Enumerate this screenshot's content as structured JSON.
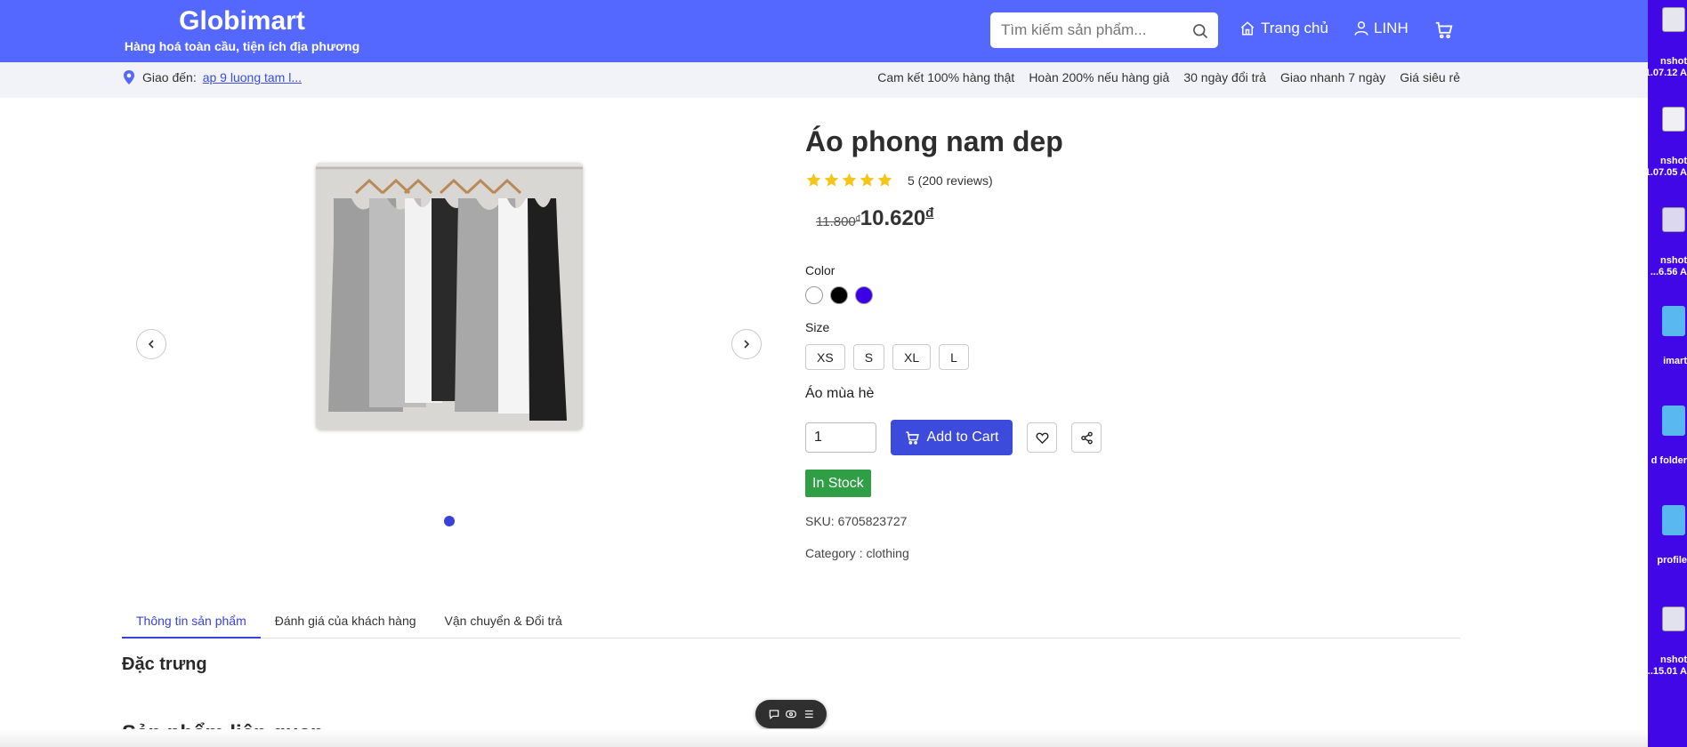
{
  "header": {
    "brand_name": "Globimart",
    "brand_tagline": "Hàng hoá toàn cầu, tiện ích địa phương",
    "search_placeholder": "Tìm kiếm sản phẩm...",
    "home_label": "Trang chủ",
    "user_label": "LINH"
  },
  "subbar": {
    "deliver_label": "Giao đến:",
    "deliver_address": "ap 9 luong tam l...",
    "promos": [
      "Cam kết 100% hàng thật",
      "Hoàn 200% nếu hàng giả",
      "30 ngày đổi trả",
      "Giao nhanh 7 ngày",
      "Giá siêu rẻ"
    ]
  },
  "gallery": {
    "slide_count": 1,
    "active_slide": 1
  },
  "product": {
    "title": "Áo phong nam dep",
    "stars": 5,
    "rating_text": "5 (200 reviews)",
    "old_price": "11.800",
    "new_price": "10.620",
    "currency": "đ",
    "color_label": "Color",
    "colors": [
      "#ffffff",
      "#000000",
      "#3d00e6"
    ],
    "size_label": "Size",
    "sizes": [
      "XS",
      "S",
      "XL",
      "L"
    ],
    "variant": "Áo mùa hè",
    "quantity": "1",
    "add_to_cart": "Add to Cart",
    "stock": "In Stock",
    "sku": "SKU: 6705823727",
    "category": "Category : clothing"
  },
  "tabs": [
    "Thông tin sản phẩm",
    "Đánh giá của khách hàng",
    "Vận chuyển & Đổi trả"
  ],
  "active_tab": 0,
  "sections": {
    "features": "Đặc trưng",
    "related": "Sản phẩm liên quan"
  },
  "desktop": {
    "items": [
      {
        "label1": "nshot",
        "label2": "1.07.12 A"
      },
      {
        "label1": "nshot",
        "label2": "1.07.05 A"
      },
      {
        "label1": "nshot",
        "label2": "...6.56 A"
      },
      {
        "label1": "imart",
        "label2": ""
      },
      {
        "label1": "d folder",
        "label2": ""
      },
      {
        "label1": "profile",
        "label2": ""
      },
      {
        "label1": "nshot",
        "label2": "..15.01 A"
      }
    ]
  },
  "colors": {
    "brand": "#5468ff",
    "accent": "#3c4bdc",
    "stock": "#2f9e44",
    "desktop": "#4207e6"
  }
}
